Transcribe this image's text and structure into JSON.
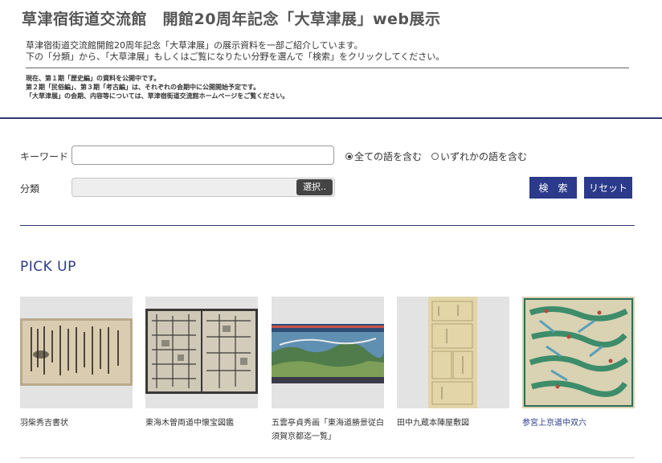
{
  "header": {
    "title": "草津宿街道交流館　開館20周年記念「大草津展」web展示",
    "intro_lines": [
      "草津宿街道交流館開館20周年記念「大草津展」の展示資料を一部ご紹介しています。",
      "下の「分類」から、「大草津展」もしくはご覧になりたい分野を選んで「検索」をクリックしてください。"
    ],
    "notes": [
      "現在、第１期「歴史編」の資料を公開中です。",
      "第２期「民俗編」、第３期「考古編」は、それぞれの会期中に公開開始予定です。",
      "「大草津展」の会期、内容等については、草津宿街道交流館ホームページをご覧ください。"
    ]
  },
  "search": {
    "keyword_label": "キーワード",
    "keyword_value": "",
    "radio_all_label": "全ての語を含む",
    "radio_any_label": "いずれかの語を含む",
    "radio_selected": "all",
    "category_label": "分類",
    "select_label": "選択..",
    "search_button": "検　索",
    "reset_button": "リセット"
  },
  "pickup": {
    "heading": "PICK UP",
    "items": [
      {
        "caption": "羽柴秀吉書状",
        "link": false
      },
      {
        "caption": "東海木曽両道中懐宝図鑑",
        "link": false
      },
      {
        "caption": "五雲亭貞秀画「東海道勝景従白須賀京都迄一覧」",
        "link": false
      },
      {
        "caption": "田中九蔵本陣屋敷図",
        "link": false
      },
      {
        "caption": "参宮上京道中双六",
        "link": true
      }
    ]
  },
  "colors": {
    "accent": "#2b3a8a",
    "rule": "#2b3a6b",
    "thumb_bg": "#e3e3e3"
  }
}
